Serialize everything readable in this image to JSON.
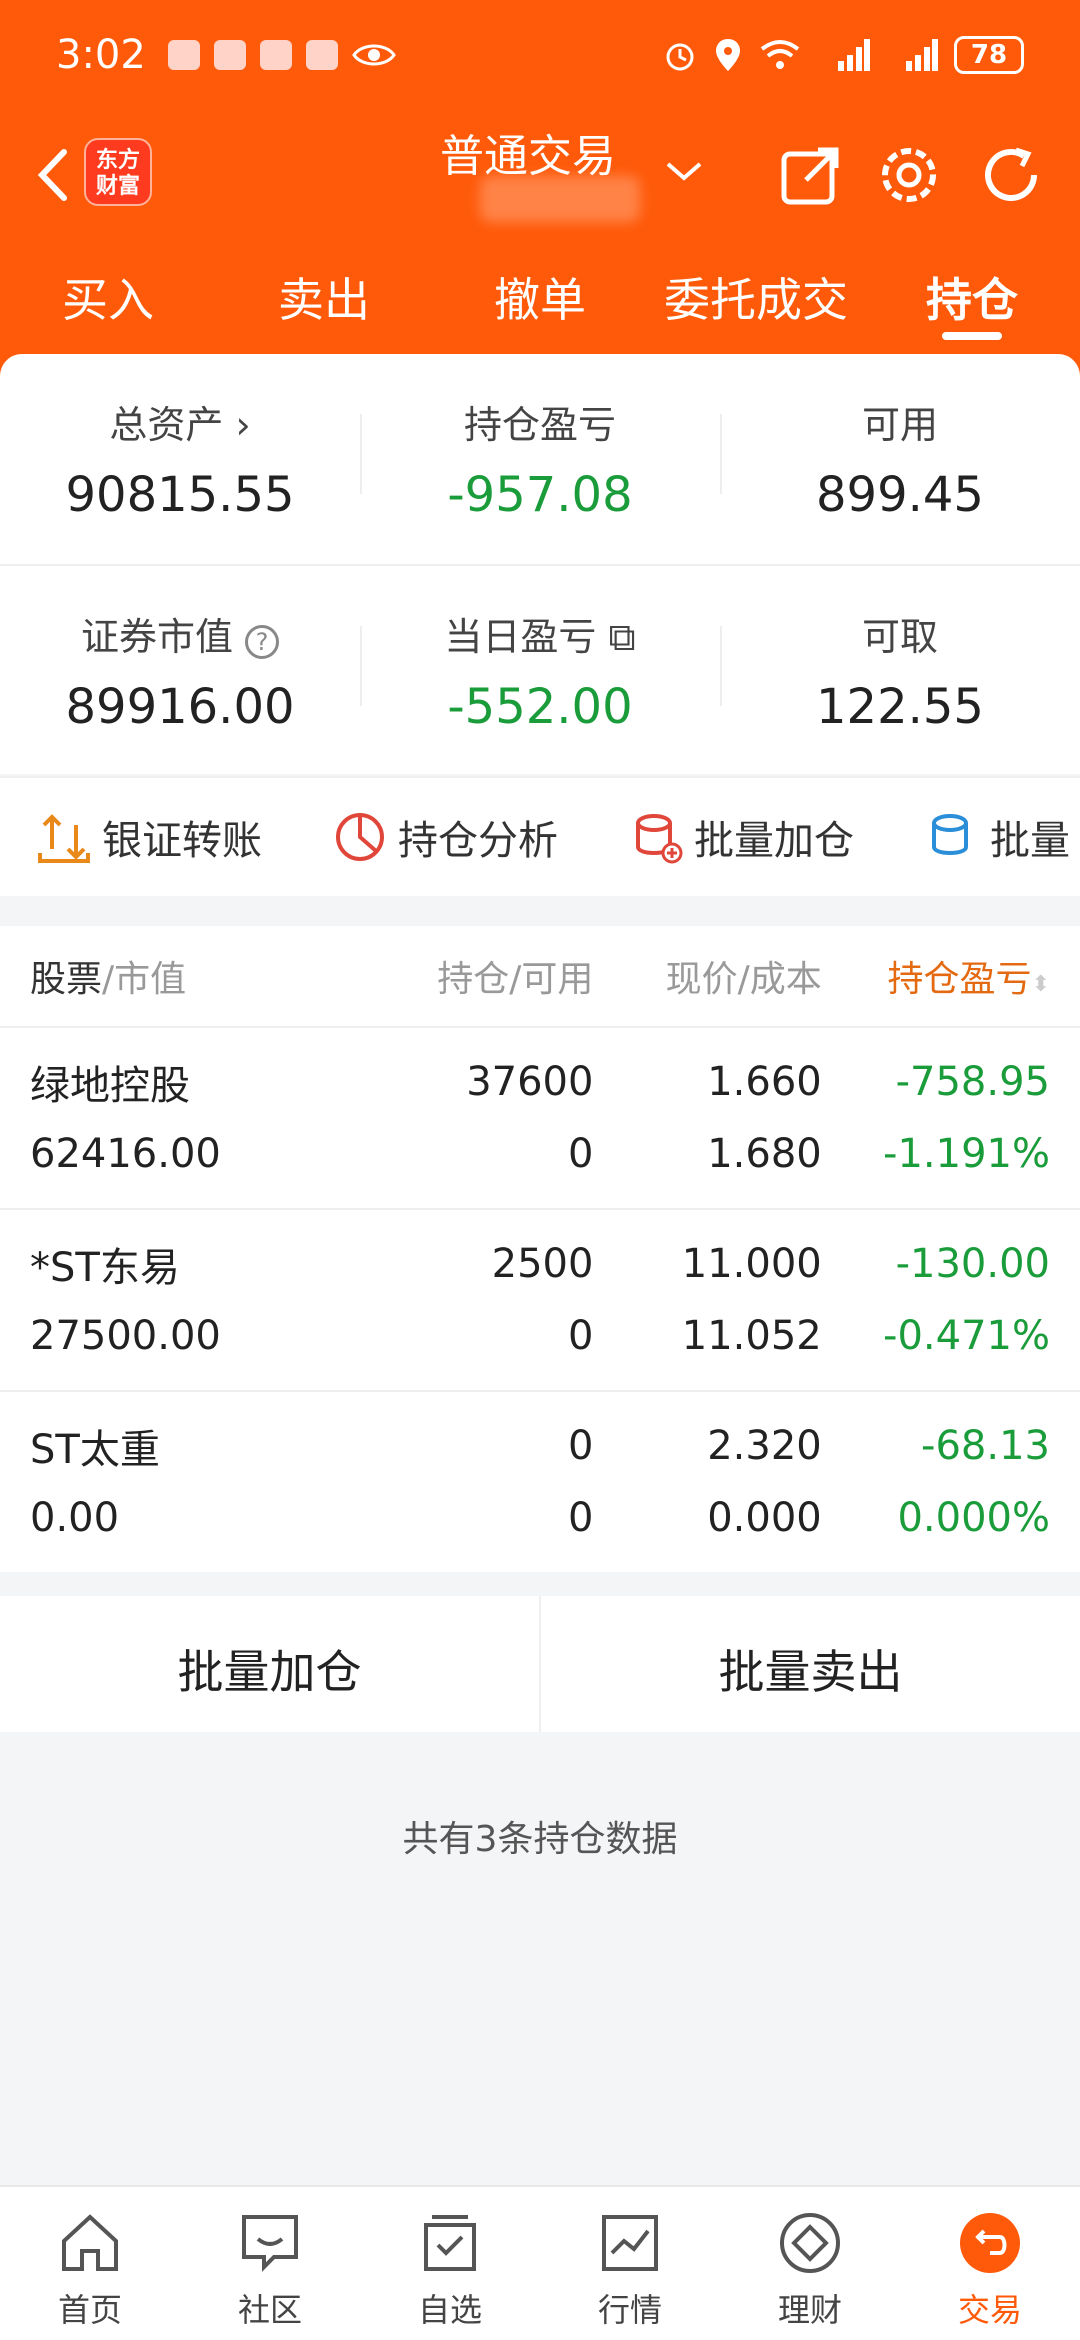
{
  "status_bar": {
    "time": "3:02",
    "battery": "78"
  },
  "header": {
    "brand": "东方财富",
    "title": "普通交易"
  },
  "tabs": [
    {
      "label": "买入"
    },
    {
      "label": "卖出"
    },
    {
      "label": "撤单"
    },
    {
      "label": "委托成交"
    },
    {
      "label": "持仓"
    }
  ],
  "summary": {
    "total_assets": {
      "label": "总资产",
      "value": "90815.55"
    },
    "position_pl": {
      "label": "持仓盈亏",
      "value": "-957.08"
    },
    "available": {
      "label": "可用",
      "value": "899.45"
    },
    "market_value": {
      "label": "证券市值",
      "value": "89916.00"
    },
    "daily_pl": {
      "label": "当日盈亏",
      "value": "-552.00"
    },
    "withdrawable": {
      "label": "可取",
      "value": "122.55"
    }
  },
  "tools": [
    {
      "label": "银证转账"
    },
    {
      "label": "持仓分析"
    },
    {
      "label": "批量加仓"
    },
    {
      "label": "批量"
    }
  ],
  "table": {
    "headers": {
      "stock": "股票",
      "stock_sub": "/市值",
      "hold": "持仓/可用",
      "price": "现价/成本",
      "pl": "持仓盈亏"
    },
    "rows": [
      {
        "name": "绿地控股",
        "value": "62416.00",
        "hold": "37600",
        "avail": "0",
        "price": "1.660",
        "cost": "1.680",
        "pl": "-758.95",
        "pl_pct": "-1.191%"
      },
      {
        "name": "*ST东易",
        "value": "27500.00",
        "hold": "2500",
        "avail": "0",
        "price": "11.000",
        "cost": "11.052",
        "pl": "-130.00",
        "pl_pct": "-0.471%"
      },
      {
        "name": "ST太重",
        "value": "0.00",
        "hold": "0",
        "avail": "0",
        "price": "2.320",
        "cost": "0.000",
        "pl": "-68.13",
        "pl_pct": "0.000%"
      }
    ]
  },
  "actions": {
    "batch_add": "批量加仓",
    "batch_sell": "批量卖出"
  },
  "footer_note": "共有3条持仓数据",
  "bottom_nav": [
    {
      "label": "首页"
    },
    {
      "label": "社区"
    },
    {
      "label": "自选"
    },
    {
      "label": "行情"
    },
    {
      "label": "理财"
    },
    {
      "label": "交易"
    }
  ],
  "colors": {
    "accent": "#ff5a0a",
    "loss": "#1a9c3a",
    "sort_header": "#e46a12"
  }
}
